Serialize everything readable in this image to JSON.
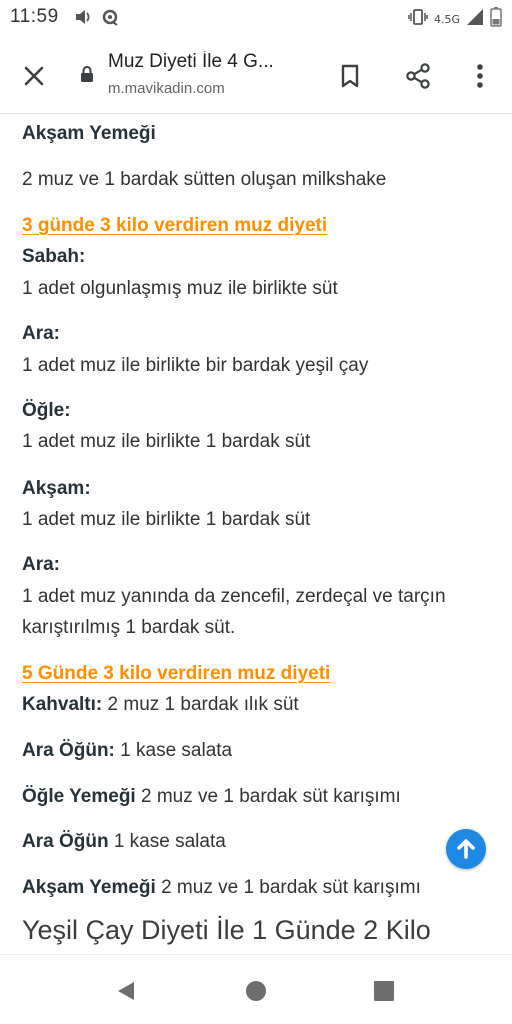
{
  "status_bar": {
    "time": "11:59",
    "network_label": "4.5G",
    "icons": [
      "volume-icon",
      "cast-icon",
      "vibrate-icon",
      "signal-icon",
      "battery-icon"
    ]
  },
  "browser": {
    "page_title": "Muz Diyeti İle 4 G...",
    "url": "m.mavikadin.com",
    "icons": [
      "close-icon",
      "lock-icon",
      "bookmark-icon",
      "share-icon",
      "more-vert-icon"
    ]
  },
  "article": {
    "aksam_label": "Akşam Yemeği",
    "aksam_text": "2 muz ve 1 bardak sütten oluşan milkshake",
    "diet3_heading": "3 günde 3 kilo verdiren muz diyeti",
    "diet3": [
      {
        "label": "Sabah:",
        "text": "1 adet olgunlaşmış muz ile birlikte süt"
      },
      {
        "label": "Ara:",
        "text": "1 adet muz ile birlikte bir bardak yeşil çay"
      },
      {
        "label": "Öğle:",
        "text": "1 adet muz ile birlikte 1 bardak süt"
      },
      {
        "label": "Akşam:",
        "text": "1 adet muz ile birlikte 1 bardak süt"
      },
      {
        "label": "Ara:",
        "text": "1 adet muz yanında da zencefil, zerdeçal ve tarçın",
        "text2": "karıştırılmış 1 bardak süt."
      }
    ],
    "diet5_heading": "5 Günde 3 kilo verdiren muz diyeti",
    "diet5": [
      {
        "label": "Kahvaltı:",
        "text": " 2 muz 1 bardak ılık süt"
      },
      {
        "label": "Ara Öğün:",
        "text": " 1 kase salata"
      },
      {
        "label": "Öğle Yemeği",
        "text": " 2 muz ve 1 bardak süt karışımı"
      },
      {
        "label": "Ara Öğün",
        "text": " 1 kase salata"
      },
      {
        "label": "Akşam Yemeği",
        "text": " 2 muz ve 1 bardak süt karışımı"
      }
    ],
    "next_heading": "Yeşil Çay Diyeti İle 1 Günde 2 Kilo"
  },
  "colors": {
    "heading_orange": "#ff8f00",
    "scroll_button_blue": "#1e88e5"
  },
  "nav_bar": {
    "icons": [
      "back-icon",
      "home-icon",
      "recents-icon"
    ]
  }
}
